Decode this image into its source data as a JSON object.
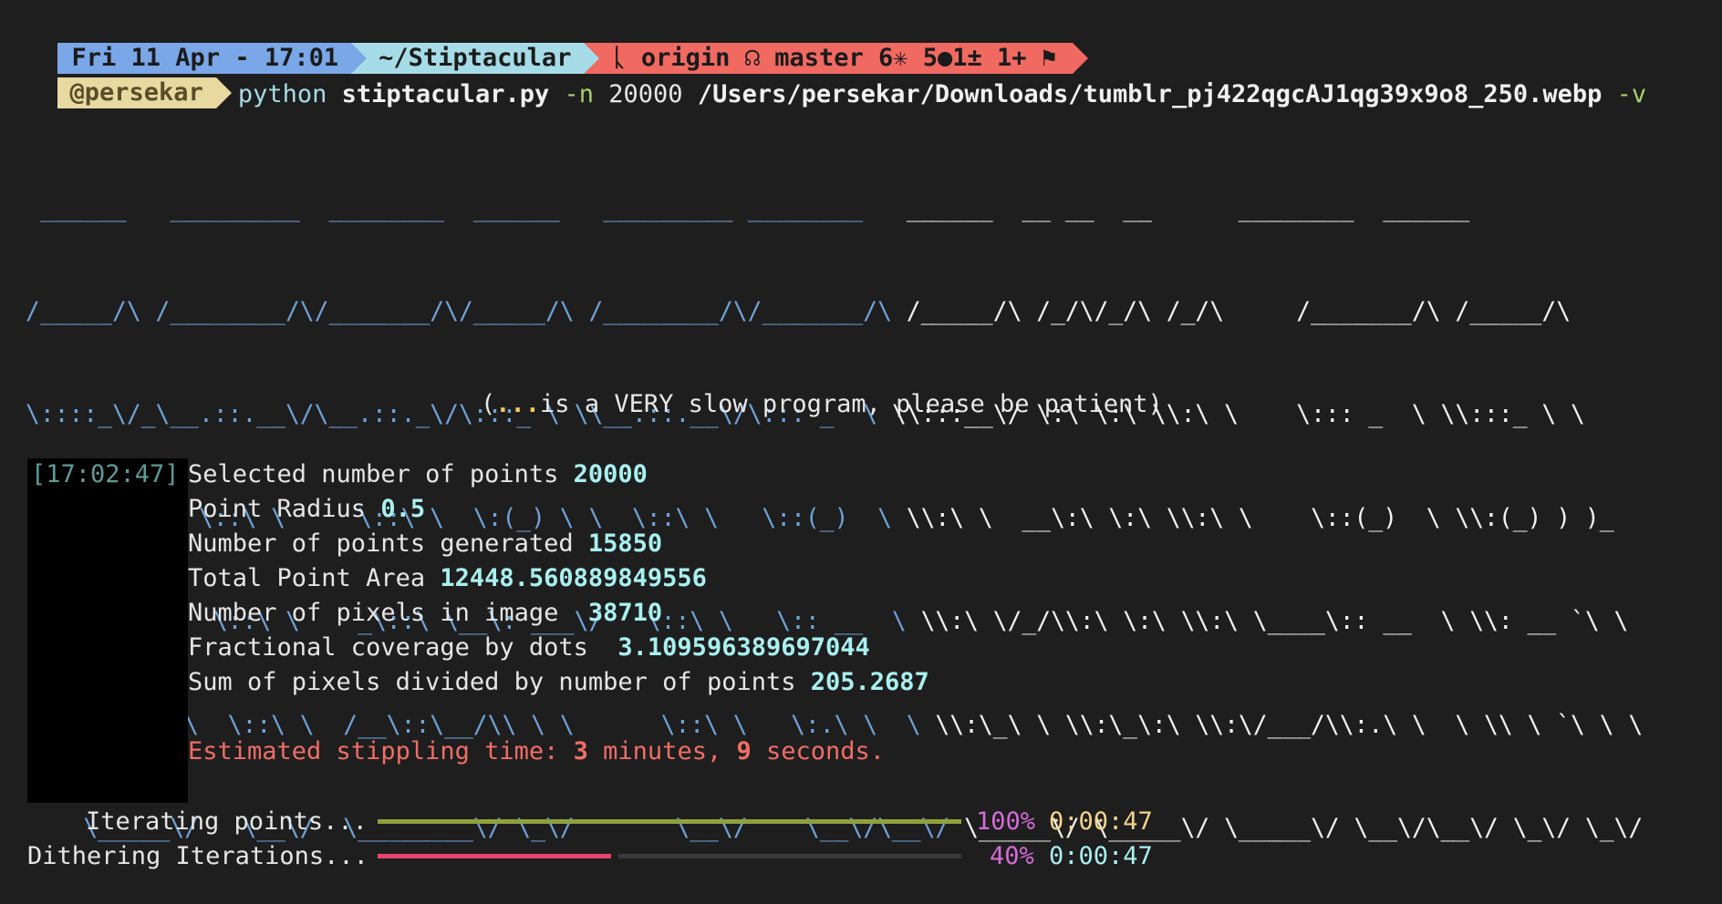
{
  "prompt": {
    "datetime": "Fri 11 Apr - 17:01",
    "directory": "~/Stiptacular",
    "git": "ᚳ origin ☊ master 6✳ 5●1± 1+ ⚑",
    "user": "@persekar"
  },
  "command": {
    "program": "python",
    "script": "stiptacular.py",
    "flag_n": "-n",
    "n_value": "20000",
    "path": "/Users/persekar/Downloads/tumblr_pj422qgcAJ1qg39x9o8_250.webp",
    "flag_v": "-v"
  },
  "banner": {
    "ascii_lines": [
      [
        " ______   _________  ________  ______   _________ ________  ",
        " ______  __ __  __      ________  ______"
      ],
      [
        "/_____/\\ /________/\\/_______/\\/_____/\\ /________/\\/_______/\\ ",
        "/_____/\\ /_/\\/_/\\ /_/\\     /_______/\\ /_____/\\"
      ],
      [
        "\\::::_\\/_\\__.::.__\\/\\__.::._\\/\\:::_ \\ \\\\__.::.__\\/\\::: _  \\ ",
        "\\\\:::__\\/ \\:\\ \\:\\ \\\\:\\ \\    \\::: _  \\ \\\\:::_ \\ \\"
      ],
      [
        " \\:\\/___/\\  \\::\\ \\     \\::\\ \\  \\:(_) \\ \\  \\::\\ \\   \\::(_)  \\ ",
        "\\\\:\\ \\  __\\:\\ \\:\\ \\\\:\\ \\    \\::(_)  \\ \\\\:(_) ) )_"
      ],
      [
        "  \\_::._\\:\\  \\::\\ \\    _\\::\\ \\__\\: ___\\/   \\::\\ \\   \\:: __  \\ ",
        "\\\\:\\ \\/_/\\\\:\\ \\:\\ \\\\:\\ \\____\\:: __  \\ \\\\: __ `\\ \\"
      ],
      [
        "    /____\\:\\  \\::\\ \\  /__\\::\\__/\\\\ \\ \\      \\::\\ \\   \\:.\\ \\  \\ ",
        "\\\\:\\_\\ \\ \\\\:\\_\\:\\ \\\\:\\/___/\\\\:.\\ \\  \\ \\\\ \\ `\\ \\ \\"
      ],
      [
        "    \\_____\\/   \\__\\/  \\________\\/ \\_\\/       \\__\\/    \\__\\/\\__\\/ ",
        "\\_____\\/ \\_____\\/ \\_____\\/ \\__\\/\\__\\/ \\_\\/ \\_\\/"
      ]
    ],
    "tagline_prefix": "(",
    "tagline_dots": "...",
    "tagline_rest": "is a VERY slow program, please be patient)"
  },
  "log": {
    "timestamp": "[17:02:47]",
    "lines": [
      {
        "label": "Selected number of points ",
        "value": "20000"
      },
      {
        "label": "Point Radius ",
        "value": "0.5"
      },
      {
        "label": "Number of points generated ",
        "value": "15850"
      },
      {
        "label": "Total Point Area ",
        "value": "12448.560889849556"
      },
      {
        "label": "Number of pixels in image  ",
        "value": "38710"
      },
      {
        "label": "Fractional coverage by dots  ",
        "value": "3.109596389697044"
      },
      {
        "label": "Sum of pixels divided by number of points ",
        "value": "205.2687"
      }
    ],
    "estimate": {
      "prefix": "Estimated stippling time: ",
      "minutes": "3",
      "minutes_label": " minutes, ",
      "seconds": "9",
      "seconds_label": " seconds."
    }
  },
  "progress": [
    {
      "label": "Iterating points...",
      "fraction": 1.0,
      "percent": "100%",
      "elapsed": "0:00:47",
      "color": "#8fa13a",
      "elapsed_color": "#f3d48a"
    },
    {
      "label": "Dithering Iterations...",
      "fraction": 0.4,
      "percent": "40%",
      "elapsed": "0:00:47",
      "color": "#e8456e",
      "elapsed_color": "#a9f0f0"
    }
  ]
}
